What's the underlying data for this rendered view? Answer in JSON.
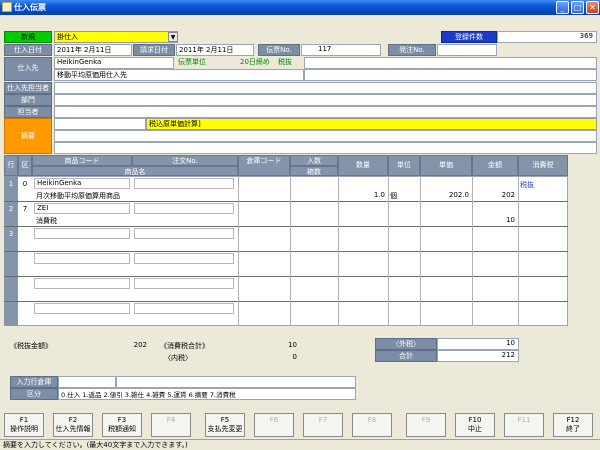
{
  "window": {
    "title": "仕入伝票",
    "btn_min": "_",
    "btn_max": "□",
    "btn_close": "✕"
  },
  "header": {
    "mode": "新規",
    "type_value": "掛仕入",
    "registered_label": "登録件数",
    "registered_count": "369",
    "purchase_date_label": "仕入日付",
    "purchase_date": "2011年 2月11日",
    "billing_date_label": "請求日付",
    "billing_date": "2011年 2月11日",
    "slip_no_label": "伝票No.",
    "slip_no": "117",
    "order_no_label": "発注No.",
    "supplier_label": "仕入先",
    "supplier_code": "HeikinGenka",
    "supplier_name": "移動平均原価用仕入先",
    "unit_label": "伝票単位",
    "closing": "20日締め",
    "tax_mode": "税抜",
    "staff_label": "仕入先担当者",
    "dept_label": "部門",
    "person_label": "担当者",
    "memo_label": "摘要",
    "memo_value": "税込原単価計算]"
  },
  "grid": {
    "headers": {
      "row": "行",
      "kubun": "区",
      "item_code": "商品コード",
      "order_no": "注文No.",
      "item_name": "商品名",
      "warehouse": "倉庫コード",
      "in_qty": "入数",
      "boxes": "箱数",
      "qty": "数量",
      "unit": "単位",
      "unit_price": "単価",
      "amount": "金額",
      "tax": "消費税"
    },
    "rows": [
      {
        "no": "1",
        "kubun": "0",
        "code": "HeikinGenka",
        "name": "月次移動平均原価算用商品",
        "qty": "1.0",
        "unit": "個",
        "price": "202.0",
        "amount": "202",
        "tax": "税抜"
      },
      {
        "no": "2",
        "kubun": "7",
        "code": "ZEI",
        "name": "消費税",
        "qty": "",
        "unit": "",
        "price": "",
        "amount": "10",
        "tax": ""
      },
      {
        "no": "3",
        "kubun": "",
        "code": "",
        "name": "",
        "qty": "",
        "unit": "",
        "price": "",
        "amount": "",
        "tax": ""
      }
    ]
  },
  "totals": {
    "net_label": "《税抜金額》",
    "net_value": "202",
    "tax_total_label": "《消費税合計》",
    "tax_total_value": "10",
    "inner_tax_label": "〈内税〉",
    "inner_tax_value": "0",
    "outer_tax_label": "〈外税〉",
    "outer_tax_value": "10",
    "grand_label": "合計",
    "grand_value": "212"
  },
  "footer": {
    "warehouse_label": "入力行倉庫",
    "kubun_label": "区分",
    "kubun_list": "0.仕入 1.返品 2.値引 3.雑仕 4.雑費 5.運賃 6.摘要 7.消費税"
  },
  "fkeys": [
    {
      "key": "F1",
      "label": "操作説明"
    },
    {
      "key": "F2",
      "label": "仕入先情報"
    },
    {
      "key": "F3",
      "label": "税額通知"
    },
    {
      "key": "F4",
      "label": ""
    },
    {
      "key": "F5",
      "label": "支払先変更"
    },
    {
      "key": "F6",
      "label": ""
    },
    {
      "key": "F7",
      "label": ""
    },
    {
      "key": "F8",
      "label": ""
    },
    {
      "key": "F9",
      "label": ""
    },
    {
      "key": "F10",
      "label": "中止"
    },
    {
      "key": "F11",
      "label": ""
    },
    {
      "key": "F12",
      "label": "終了"
    }
  ],
  "status": "摘要を入力してください。(最大40文字まで入力できます。)",
  "colors": {
    "label_bg": "#7c8ea6",
    "mode_green": "#00cc00",
    "highlight_yellow": "#ffff00",
    "accent_orange": "#ff9900",
    "counter_blue": "#1a3cc9"
  }
}
